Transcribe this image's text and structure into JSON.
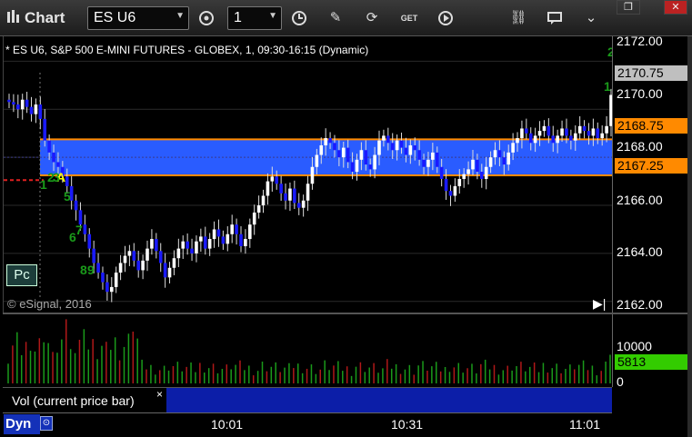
{
  "toolbar": {
    "title": "Chart",
    "symbol": "ES U6",
    "interval": "1",
    "tools": [
      "cycle-icon",
      "clock-icon",
      "pencil-icon",
      "refresh-icon",
      "get-icon",
      "play-icon",
      "link-icon",
      "chat-icon",
      "chevron-down-icon"
    ]
  },
  "window": {
    "restore": "❐",
    "close": "✕"
  },
  "chart": {
    "header": "* ES U6, S&P 500 E-MINI FUTURES - GLOBEX, 1, 09:30-16:15 (Dynamic)",
    "copyright": "© eSignal, 2016",
    "pc_label": "Pc",
    "price_labels": [
      "2172.00",
      "2170.00",
      "2168.00",
      "2166.00",
      "2164.00",
      "2162.00"
    ],
    "tags": {
      "last": "2170.75",
      "upper": "2168.75",
      "lower": "2167.25"
    },
    "annotations": [
      "A",
      "1",
      "2",
      "3",
      "5",
      "6",
      "7",
      "8",
      "9",
      "1",
      "2"
    ],
    "volume": {
      "legend": "Vol (current price bar)",
      "close": "×",
      "labels": [
        "10000",
        "0"
      ],
      "current": "5813"
    },
    "time_labels": [
      "10:01",
      "10:31",
      "11:01"
    ],
    "mode": "Dyn",
    "colors": {
      "zone_fill": "#2a5cff",
      "zone_border": "#ff8a00",
      "up_candle": "#ffffff",
      "down_candle": "#1a1aff",
      "vol_up": "#1a9a1a",
      "vol_down": "#b01818",
      "current_vol": "#33cc00",
      "last_price": "#bfbfbf"
    }
  },
  "chart_data": {
    "type": "candlestick",
    "ylim": [
      2161.5,
      2173.0
    ],
    "zone": [
      2167.25,
      2168.75
    ],
    "last": 2170.75,
    "x_labels": [
      "10:01",
      "10:31",
      "11:01"
    ]
  }
}
